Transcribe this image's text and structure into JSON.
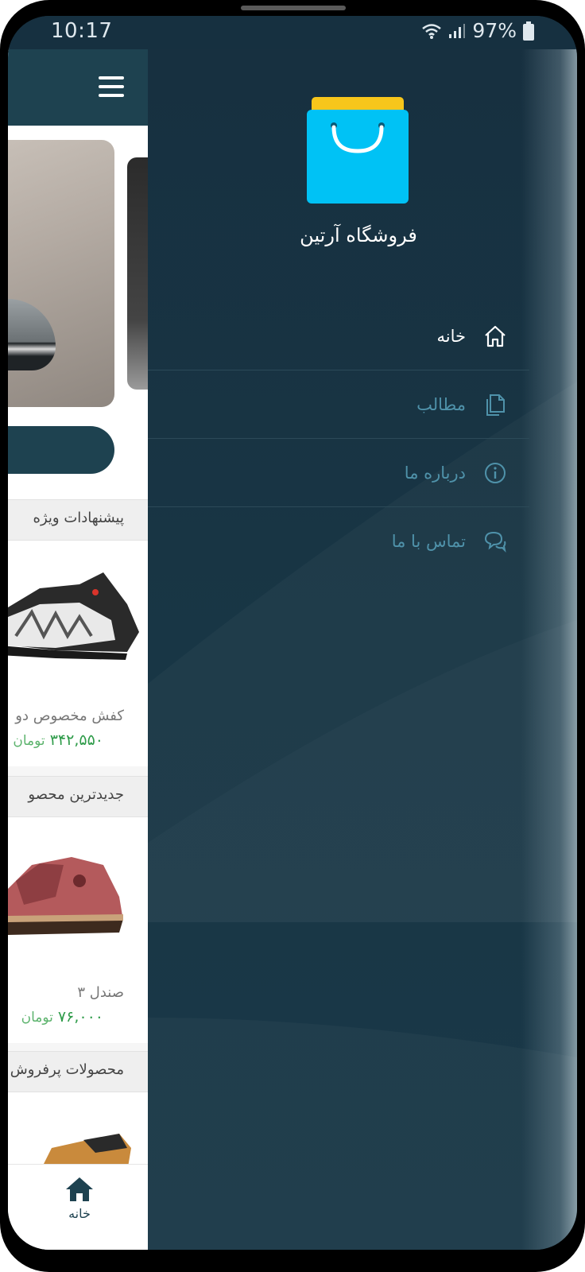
{
  "status_bar": {
    "time": "10:17",
    "battery": "97%"
  },
  "drawer": {
    "store_name": "فروشگاه آرتین",
    "menu": [
      {
        "label": "خانه",
        "icon": "home-icon",
        "active": true
      },
      {
        "label": "مطالب",
        "icon": "documents-icon",
        "active": false
      },
      {
        "label": "درباره ما",
        "icon": "info-icon",
        "active": false
      },
      {
        "label": "تماس با ما",
        "icon": "chat-icon",
        "active": false
      }
    ]
  },
  "main": {
    "sections": [
      {
        "title": "پیشنهادات ویژه",
        "product": {
          "name": "کفش مخصوص دو",
          "price": "۳۴۲,۵۵۰",
          "unit": "تومان"
        }
      },
      {
        "title": "جدیدترین محصو",
        "product": {
          "name": "صندل ۳",
          "price": "۷۶,۰۰۰",
          "unit": "تومان"
        }
      },
      {
        "title": "محصولات پرفروش",
        "product": null
      }
    ]
  },
  "bottom_nav": {
    "home_label": "خانه"
  },
  "colors": {
    "primary": "#1e4250",
    "drawer_bg": "#173040",
    "price_green": "#2e9b49",
    "logo_bag": "#00c2f5",
    "logo_top": "#f7c61b"
  }
}
